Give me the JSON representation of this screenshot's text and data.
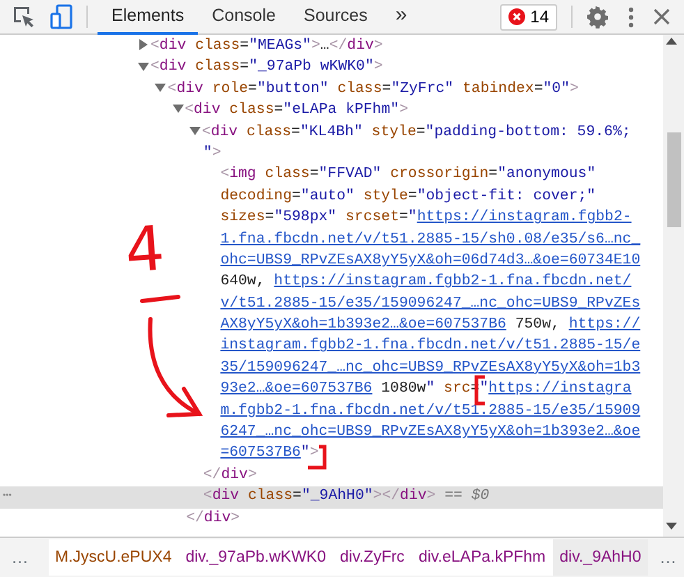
{
  "toolbar": {
    "tabs": [
      {
        "label": "Elements",
        "selected": true
      },
      {
        "label": "Console",
        "selected": false
      },
      {
        "label": "Sources",
        "selected": false
      }
    ],
    "overflow": "»",
    "error_count": "14"
  },
  "elements_panel": {
    "selected_marker": "•••",
    "nodes": [
      {
        "expanded": false,
        "lines": [
          [
            {
              "kind": "bracket",
              "text": "<"
            },
            {
              "kind": "tag",
              "text": "div"
            },
            {
              "kind": "attr",
              "text": " class"
            },
            {
              "kind": "text",
              "text": "="
            },
            {
              "kind": "value",
              "text": "\"MEAGs\""
            },
            {
              "kind": "bracket",
              "text": ">"
            },
            {
              "kind": "text",
              "text": "…"
            },
            {
              "kind": "bracket",
              "text": "</"
            },
            {
              "kind": "tag",
              "text": "div"
            },
            {
              "kind": "bracket",
              "text": ">"
            }
          ]
        ]
      },
      {
        "expanded": true,
        "lines": [
          [
            {
              "kind": "bracket",
              "text": "<"
            },
            {
              "kind": "tag",
              "text": "div"
            },
            {
              "kind": "attr",
              "text": " class"
            },
            {
              "kind": "text",
              "text": "="
            },
            {
              "kind": "value",
              "text": "\"_97aPb wKWK0\""
            },
            {
              "kind": "bracket",
              "text": ">"
            }
          ]
        ],
        "children": [
          {
            "expanded": true,
            "lines": [
              [
                {
                  "kind": "bracket",
                  "text": "<"
                },
                {
                  "kind": "tag",
                  "text": "div"
                },
                {
                  "kind": "attr",
                  "text": " role"
                },
                {
                  "kind": "text",
                  "text": "="
                },
                {
                  "kind": "value",
                  "text": "\"button\""
                },
                {
                  "kind": "attr",
                  "text": " class"
                },
                {
                  "kind": "text",
                  "text": "="
                },
                {
                  "kind": "value",
                  "text": "\"ZyFrc\""
                },
                {
                  "kind": "attr",
                  "text": " tabindex"
                },
                {
                  "kind": "text",
                  "text": "="
                },
                {
                  "kind": "value",
                  "text": "\"0\""
                },
                {
                  "kind": "bracket",
                  "text": ">"
                }
              ]
            ],
            "children": [
              {
                "expanded": true,
                "lines": [
                  [
                    {
                      "kind": "bracket",
                      "text": "<"
                    },
                    {
                      "kind": "tag",
                      "text": "div"
                    },
                    {
                      "kind": "attr",
                      "text": " class"
                    },
                    {
                      "kind": "text",
                      "text": "="
                    },
                    {
                      "kind": "value",
                      "text": "\"eLAPa kPFhm\""
                    },
                    {
                      "kind": "bracket",
                      "text": ">"
                    }
                  ]
                ],
                "children": [
                  {
                    "expanded": true,
                    "lines": [
                      [
                        {
                          "kind": "bracket",
                          "text": "<"
                        },
                        {
                          "kind": "tag",
                          "text": "div"
                        },
                        {
                          "kind": "attr",
                          "text": " class"
                        },
                        {
                          "kind": "text",
                          "text": "="
                        },
                        {
                          "kind": "value",
                          "text": "\"KL4Bh\""
                        },
                        {
                          "kind": "attr",
                          "text": " style"
                        },
                        {
                          "kind": "text",
                          "text": "="
                        },
                        {
                          "kind": "value",
                          "text": "\"padding-bottom: 59.6%;"
                        }
                      ],
                      [
                        {
                          "kind": "value",
                          "text": "\""
                        },
                        {
                          "kind": "bracket",
                          "text": ">"
                        }
                      ]
                    ],
                    "children": [
                      {
                        "lines": [
                          [
                            {
                              "kind": "bracket",
                              "text": "<"
                            },
                            {
                              "kind": "tag",
                              "text": "img"
                            },
                            {
                              "kind": "attr",
                              "text": " class"
                            },
                            {
                              "kind": "text",
                              "text": "="
                            },
                            {
                              "kind": "value",
                              "text": "\"FFVAD\""
                            },
                            {
                              "kind": "attr",
                              "text": " crossorigin"
                            },
                            {
                              "kind": "text",
                              "text": "="
                            },
                            {
                              "kind": "value",
                              "text": "\"anonymous\""
                            }
                          ],
                          [
                            {
                              "kind": "attr",
                              "text": "decoding"
                            },
                            {
                              "kind": "text",
                              "text": "="
                            },
                            {
                              "kind": "value",
                              "text": "\"auto\""
                            },
                            {
                              "kind": "attr",
                              "text": " style"
                            },
                            {
                              "kind": "text",
                              "text": "="
                            },
                            {
                              "kind": "value",
                              "text": "\"object-fit: cover;\""
                            }
                          ],
                          [
                            {
                              "kind": "attr",
                              "text": "sizes"
                            },
                            {
                              "kind": "text",
                              "text": "="
                            },
                            {
                              "kind": "value",
                              "text": "\"598px\""
                            },
                            {
                              "kind": "attr",
                              "text": " srcset"
                            },
                            {
                              "kind": "text",
                              "text": "="
                            },
                            {
                              "kind": "value",
                              "text": "\""
                            },
                            {
                              "kind": "url",
                              "text": "https://instagram.fgbb2-"
                            }
                          ],
                          [
                            {
                              "kind": "url",
                              "text": "1.fna.fbcdn.net/v/t51.2885-15/sh0.08/e35/s6…nc_"
                            }
                          ],
                          [
                            {
                              "kind": "url",
                              "text": "ohc=UBS9_RPvZEsAX8yY5yX&oh=06d74d3…&oe=60734E10"
                            }
                          ],
                          [
                            {
                              "kind": "text",
                              "text": "640w, "
                            },
                            {
                              "kind": "url",
                              "text": "https://instagram.fgbb2-1.fna.fbcdn.net/"
                            }
                          ],
                          [
                            {
                              "kind": "url",
                              "text": "v/t51.2885-15/e35/159096247_…nc_ohc=UBS9_RPvZEs"
                            }
                          ],
                          [
                            {
                              "kind": "url",
                              "text": "AX8yY5yX&oh=1b393e2…&oe=607537B6"
                            },
                            {
                              "kind": "text",
                              "text": " 750w, "
                            },
                            {
                              "kind": "url",
                              "text": "https://"
                            }
                          ],
                          [
                            {
                              "kind": "url",
                              "text": "instagram.fgbb2-1.fna.fbcdn.net/v/t51.2885-15/e"
                            }
                          ],
                          [
                            {
                              "kind": "url",
                              "text": "35/159096247_…nc_ohc=UBS9_RPvZEsAX8yY5yX&oh=1b3"
                            }
                          ],
                          [
                            {
                              "kind": "url",
                              "text": "93e2…&oe=607537B6"
                            },
                            {
                              "kind": "text",
                              "text": " 1080w"
                            },
                            {
                              "kind": "value",
                              "text": "\""
                            },
                            {
                              "kind": "attr",
                              "text": " src"
                            },
                            {
                              "kind": "text",
                              "text": "="
                            },
                            {
                              "kind": "value",
                              "text": "\""
                            },
                            {
                              "kind": "url",
                              "text": "https://instagra"
                            }
                          ],
                          [
                            {
                              "kind": "url",
                              "text": "m.fgbb2-1.fna.fbcdn.net/v/t51.2885-15/e35/15909"
                            }
                          ],
                          [
                            {
                              "kind": "url",
                              "text": "6247_…nc_ohc=UBS9_RPvZEsAX8yY5yX&oh=1b393e2…&oe"
                            }
                          ],
                          [
                            {
                              "kind": "url",
                              "text": "=607537B6"
                            },
                            {
                              "kind": "value",
                              "text": "\""
                            },
                            {
                              "kind": "bracket",
                              "text": ">"
                            }
                          ]
                        ]
                      }
                    ],
                    "closing": [
                      {
                        "kind": "bracket",
                        "text": "</"
                      },
                      {
                        "kind": "tag",
                        "text": "div"
                      },
                      {
                        "kind": "bracket",
                        "text": ">"
                      }
                    ]
                  },
                  {
                    "selected": true,
                    "lines": [
                      [
                        {
                          "kind": "bracket",
                          "text": "<"
                        },
                        {
                          "kind": "tag",
                          "text": "div"
                        },
                        {
                          "kind": "attr",
                          "text": " class"
                        },
                        {
                          "kind": "text",
                          "text": "="
                        },
                        {
                          "kind": "value",
                          "text": "\"_9AhH0\""
                        },
                        {
                          "kind": "bracket",
                          "text": "></"
                        },
                        {
                          "kind": "tag",
                          "text": "div"
                        },
                        {
                          "kind": "bracket",
                          "text": ">"
                        }
                      ]
                    ],
                    "suffix": " == $0"
                  }
                ],
                "closing": [
                  {
                    "kind": "bracket",
                    "text": "</"
                  },
                  {
                    "kind": "tag",
                    "text": "div"
                  },
                  {
                    "kind": "bracket",
                    "text": ">"
                  }
                ]
              }
            ]
          }
        ]
      }
    ]
  },
  "annotation": {
    "text": "4"
  },
  "breadcrumbs": {
    "leading": "…",
    "trailing": "…",
    "items": [
      {
        "text": "M.JyscU.ePUX4",
        "kind": "cut",
        "selected": false
      },
      {
        "text": "div._97aPb.wKWK0",
        "kind": "element",
        "selected": false
      },
      {
        "text": "div.ZyFrc",
        "kind": "element",
        "selected": false
      },
      {
        "text": "div.eLAPa.kPFhm",
        "kind": "element",
        "selected": false
      },
      {
        "text": "div._9AhH0",
        "kind": "element",
        "selected": true
      }
    ]
  }
}
